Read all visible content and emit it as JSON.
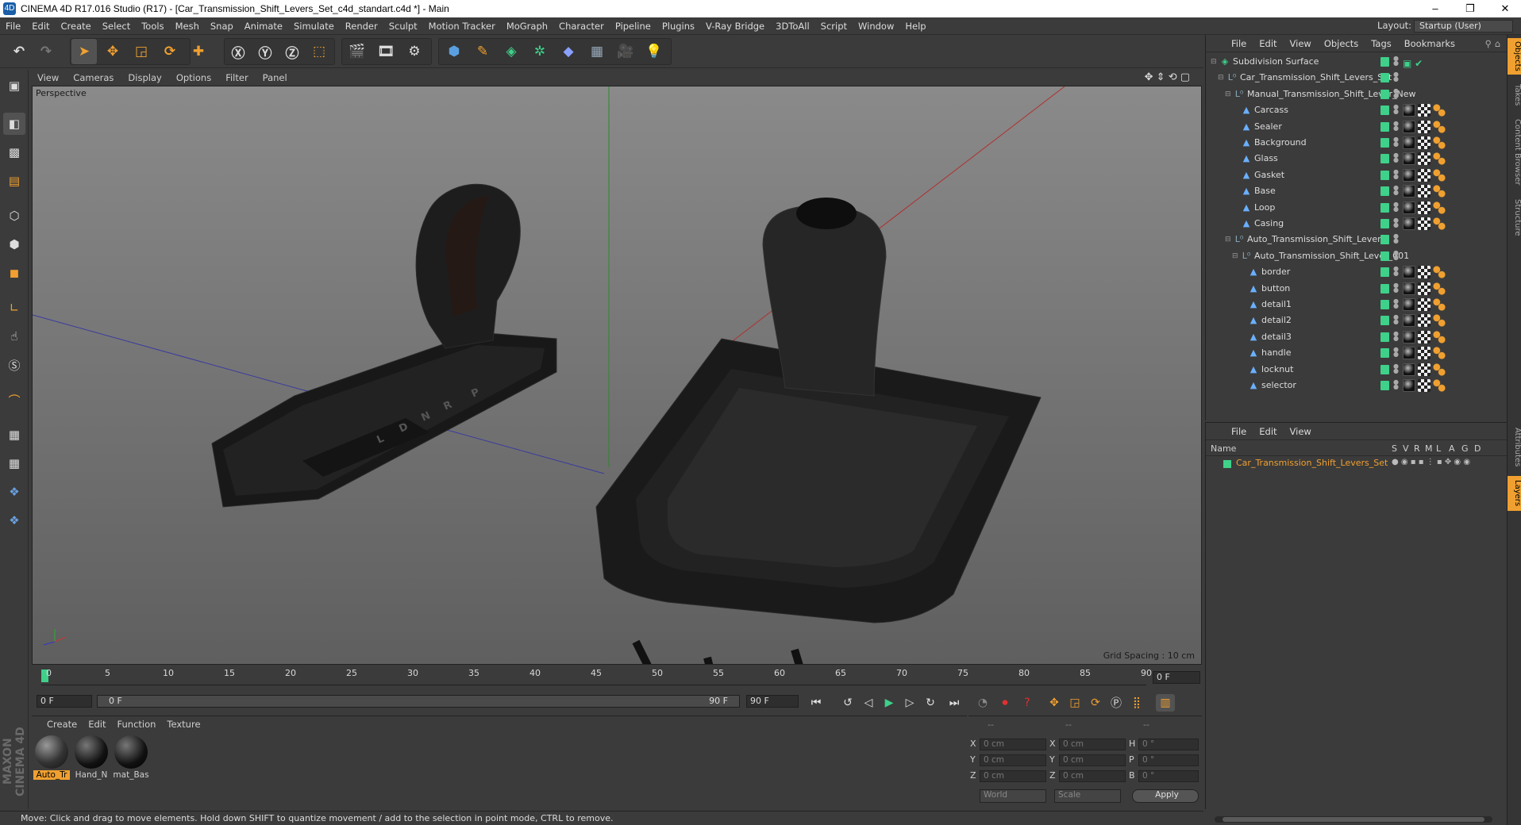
{
  "window": {
    "title": "CINEMA 4D R17.016 Studio (R17) - [Car_Transmission_Shift_Levers_Set_c4d_standart.c4d *] - Main",
    "minimize": "–",
    "restore": "❐",
    "close": "✕"
  },
  "menubar": {
    "items": [
      "File",
      "Edit",
      "Create",
      "Select",
      "Tools",
      "Mesh",
      "Snap",
      "Animate",
      "Simulate",
      "Render",
      "Sculpt",
      "Motion Tracker",
      "MoGraph",
      "Character",
      "Pipeline",
      "Plugins",
      "V-Ray Bridge",
      "3DToAll",
      "Script",
      "Window",
      "Help"
    ],
    "layout_label": "Layout:",
    "layout_value": "Startup (User)"
  },
  "viewport": {
    "menu": [
      "View",
      "Cameras",
      "Display",
      "Options",
      "Filter",
      "Panel"
    ],
    "label": "Perspective",
    "grid_spacing": "Grid Spacing : 10 cm",
    "gear_letters": [
      "P",
      "R",
      "N",
      "D",
      "L"
    ]
  },
  "timeline": {
    "ticks": [
      "0",
      "5",
      "10",
      "15",
      "20",
      "25",
      "30",
      "35",
      "40",
      "45",
      "50",
      "55",
      "60",
      "65",
      "70",
      "75",
      "80",
      "85",
      "90"
    ],
    "current_frame": "0 F",
    "start_field": "0 F",
    "range_start": "0 F",
    "range_end": "90 F",
    "end_field": "90 F"
  },
  "materials": {
    "menu": [
      "Create",
      "Edit",
      "Function",
      "Texture"
    ],
    "items": [
      {
        "label": "Auto_Tr",
        "selected": true
      },
      {
        "label": "Hand_N",
        "selected": false
      },
      {
        "label": "mat_Bas",
        "selected": false
      }
    ]
  },
  "coordinates": {
    "header": [
      "--",
      "--",
      "--"
    ],
    "rows": [
      {
        "axis": "X",
        "pos": "0 cm",
        "size_axis": "X",
        "size": "0 cm",
        "rot_axis": "H",
        "rot": "0 °"
      },
      {
        "axis": "Y",
        "pos": "0 cm",
        "size_axis": "Y",
        "size": "0 cm",
        "rot_axis": "P",
        "rot": "0 °"
      },
      {
        "axis": "Z",
        "pos": "0 cm",
        "size_axis": "Z",
        "size": "0 cm",
        "rot_axis": "B",
        "rot": "0 °"
      }
    ],
    "world": "World",
    "scale": "Scale",
    "apply": "Apply"
  },
  "status": "Move: Click and drag to move elements. Hold down SHIFT to quantize movement / add to the selection in point mode, CTRL to remove.",
  "brand": "MAXON CINEMA 4D",
  "objects": {
    "menu": [
      "File",
      "Edit",
      "View",
      "Objects",
      "Tags",
      "Bookmarks"
    ],
    "rows": [
      {
        "name": "Subdivision Surface",
        "depth": 0,
        "type": "subdiv",
        "tags": "check"
      },
      {
        "name": "Car_Transmission_Shift_Levers_Set",
        "depth": 1,
        "type": "null",
        "tags": "none"
      },
      {
        "name": "Manual_Transmission_Shift_Lever_New",
        "depth": 2,
        "type": "null",
        "tags": "none"
      },
      {
        "name": "Carcass",
        "depth": 3,
        "type": "poly",
        "tags": "sphere"
      },
      {
        "name": "Sealer",
        "depth": 3,
        "type": "poly",
        "tags": "sphere"
      },
      {
        "name": "Background",
        "depth": 3,
        "type": "poly",
        "tags": "sphere"
      },
      {
        "name": "Glass",
        "depth": 3,
        "type": "poly",
        "tags": "sphere"
      },
      {
        "name": "Gasket",
        "depth": 3,
        "type": "poly",
        "tags": "sphere"
      },
      {
        "name": "Base",
        "depth": 3,
        "type": "poly",
        "tags": "sphere"
      },
      {
        "name": "Loop",
        "depth": 3,
        "type": "poly",
        "tags": "sphere"
      },
      {
        "name": "Casing",
        "depth": 3,
        "type": "poly",
        "tags": "sphere"
      },
      {
        "name": "Auto_Transmission_Shift_Lever",
        "depth": 2,
        "type": "null",
        "tags": "none"
      },
      {
        "name": "Auto_Transmission_Shift_Lever_001",
        "depth": 3,
        "type": "null",
        "tags": "none"
      },
      {
        "name": "border",
        "depth": 4,
        "type": "poly",
        "tags": "auto"
      },
      {
        "name": "button",
        "depth": 4,
        "type": "poly",
        "tags": "auto"
      },
      {
        "name": "detail1",
        "depth": 4,
        "type": "poly",
        "tags": "auto"
      },
      {
        "name": "detail2",
        "depth": 4,
        "type": "poly",
        "tags": "auto"
      },
      {
        "name": "detail3",
        "depth": 4,
        "type": "poly",
        "tags": "auto"
      },
      {
        "name": "handle",
        "depth": 4,
        "type": "poly",
        "tags": "auto"
      },
      {
        "name": "locknut",
        "depth": 4,
        "type": "poly",
        "tags": "auto"
      },
      {
        "name": "selector",
        "depth": 4,
        "type": "poly",
        "tags": "auto"
      }
    ]
  },
  "layers": {
    "menu": [
      "File",
      "Edit",
      "View"
    ],
    "columns": [
      "Name",
      "S",
      "V",
      "R",
      "M",
      "L",
      "A",
      "G",
      "D"
    ],
    "rows": [
      {
        "name": "Car_Transmission_Shift_Levers_Set",
        "color": "#3fd08a"
      }
    ]
  },
  "side_tabs": [
    "Objects",
    "Takes",
    "Content Browser",
    "Structure",
    "Attributes",
    "Layers"
  ],
  "colors": {
    "accent": "#f0a030",
    "visible": "#3fd08a",
    "selected_text": "#f0a030"
  }
}
